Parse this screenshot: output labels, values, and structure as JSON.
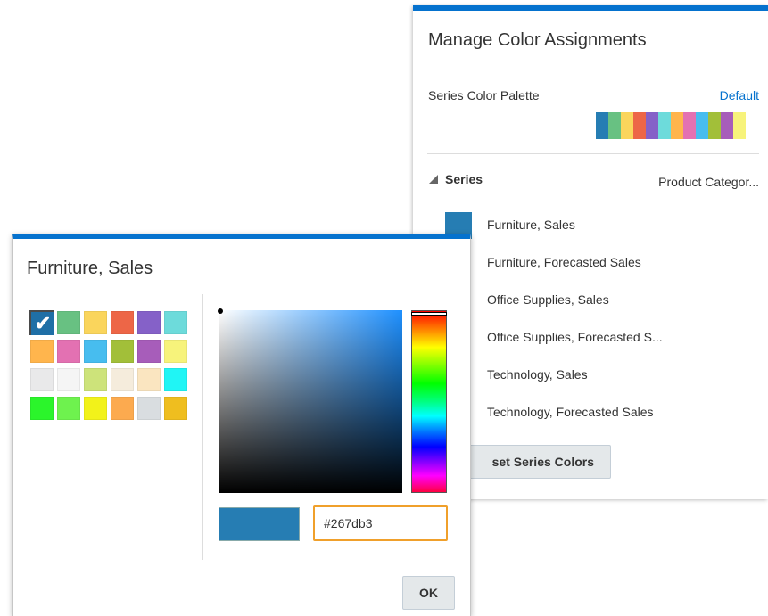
{
  "manage_panel": {
    "title": "Manage Color Assignments",
    "palette_label": "Series Color Palette",
    "palette_value": "Default",
    "palette_colors": [
      "#267db3",
      "#68c182",
      "#fad55c",
      "#ed6647",
      "#8561c8",
      "#6ddbdb",
      "#ffb54d",
      "#e371b2",
      "#47bdef",
      "#a2bf39",
      "#a75dba",
      "#f7f37b"
    ],
    "series_label": "Series",
    "series_category": "Product Categor...",
    "series_swatch_color": "#267db3",
    "series_items": [
      "Furniture, Sales",
      "Furniture, Forecasted Sales",
      "Office Supplies, Sales",
      "Office Supplies, Forecasted S...",
      "Technology, Sales",
      "Technology, Forecasted Sales"
    ],
    "reset_label": "set Series Colors"
  },
  "color_dialog": {
    "title": "Furniture, Sales",
    "selected_index": 0,
    "swatches": [
      "#267db3",
      "#68c182",
      "#fad55c",
      "#ed6647",
      "#8561c8",
      "#6ddbdb",
      "#ffb54d",
      "#e371b2",
      "#47bdef",
      "#a2bf39",
      "#a75dba",
      "#f7f37b",
      "#e9e9ea",
      "#f5f5f5",
      "#cde37a",
      "#f5ecdc",
      "#fae5c0",
      "#20f5f5",
      "#2bf52b",
      "#6ef24e",
      "#f2f21a",
      "#fcaa4f",
      "#d9dde0",
      "#efbe1f"
    ],
    "hex_value": "#267db3",
    "preview_color": "#267db3",
    "ok_label": "OK"
  }
}
